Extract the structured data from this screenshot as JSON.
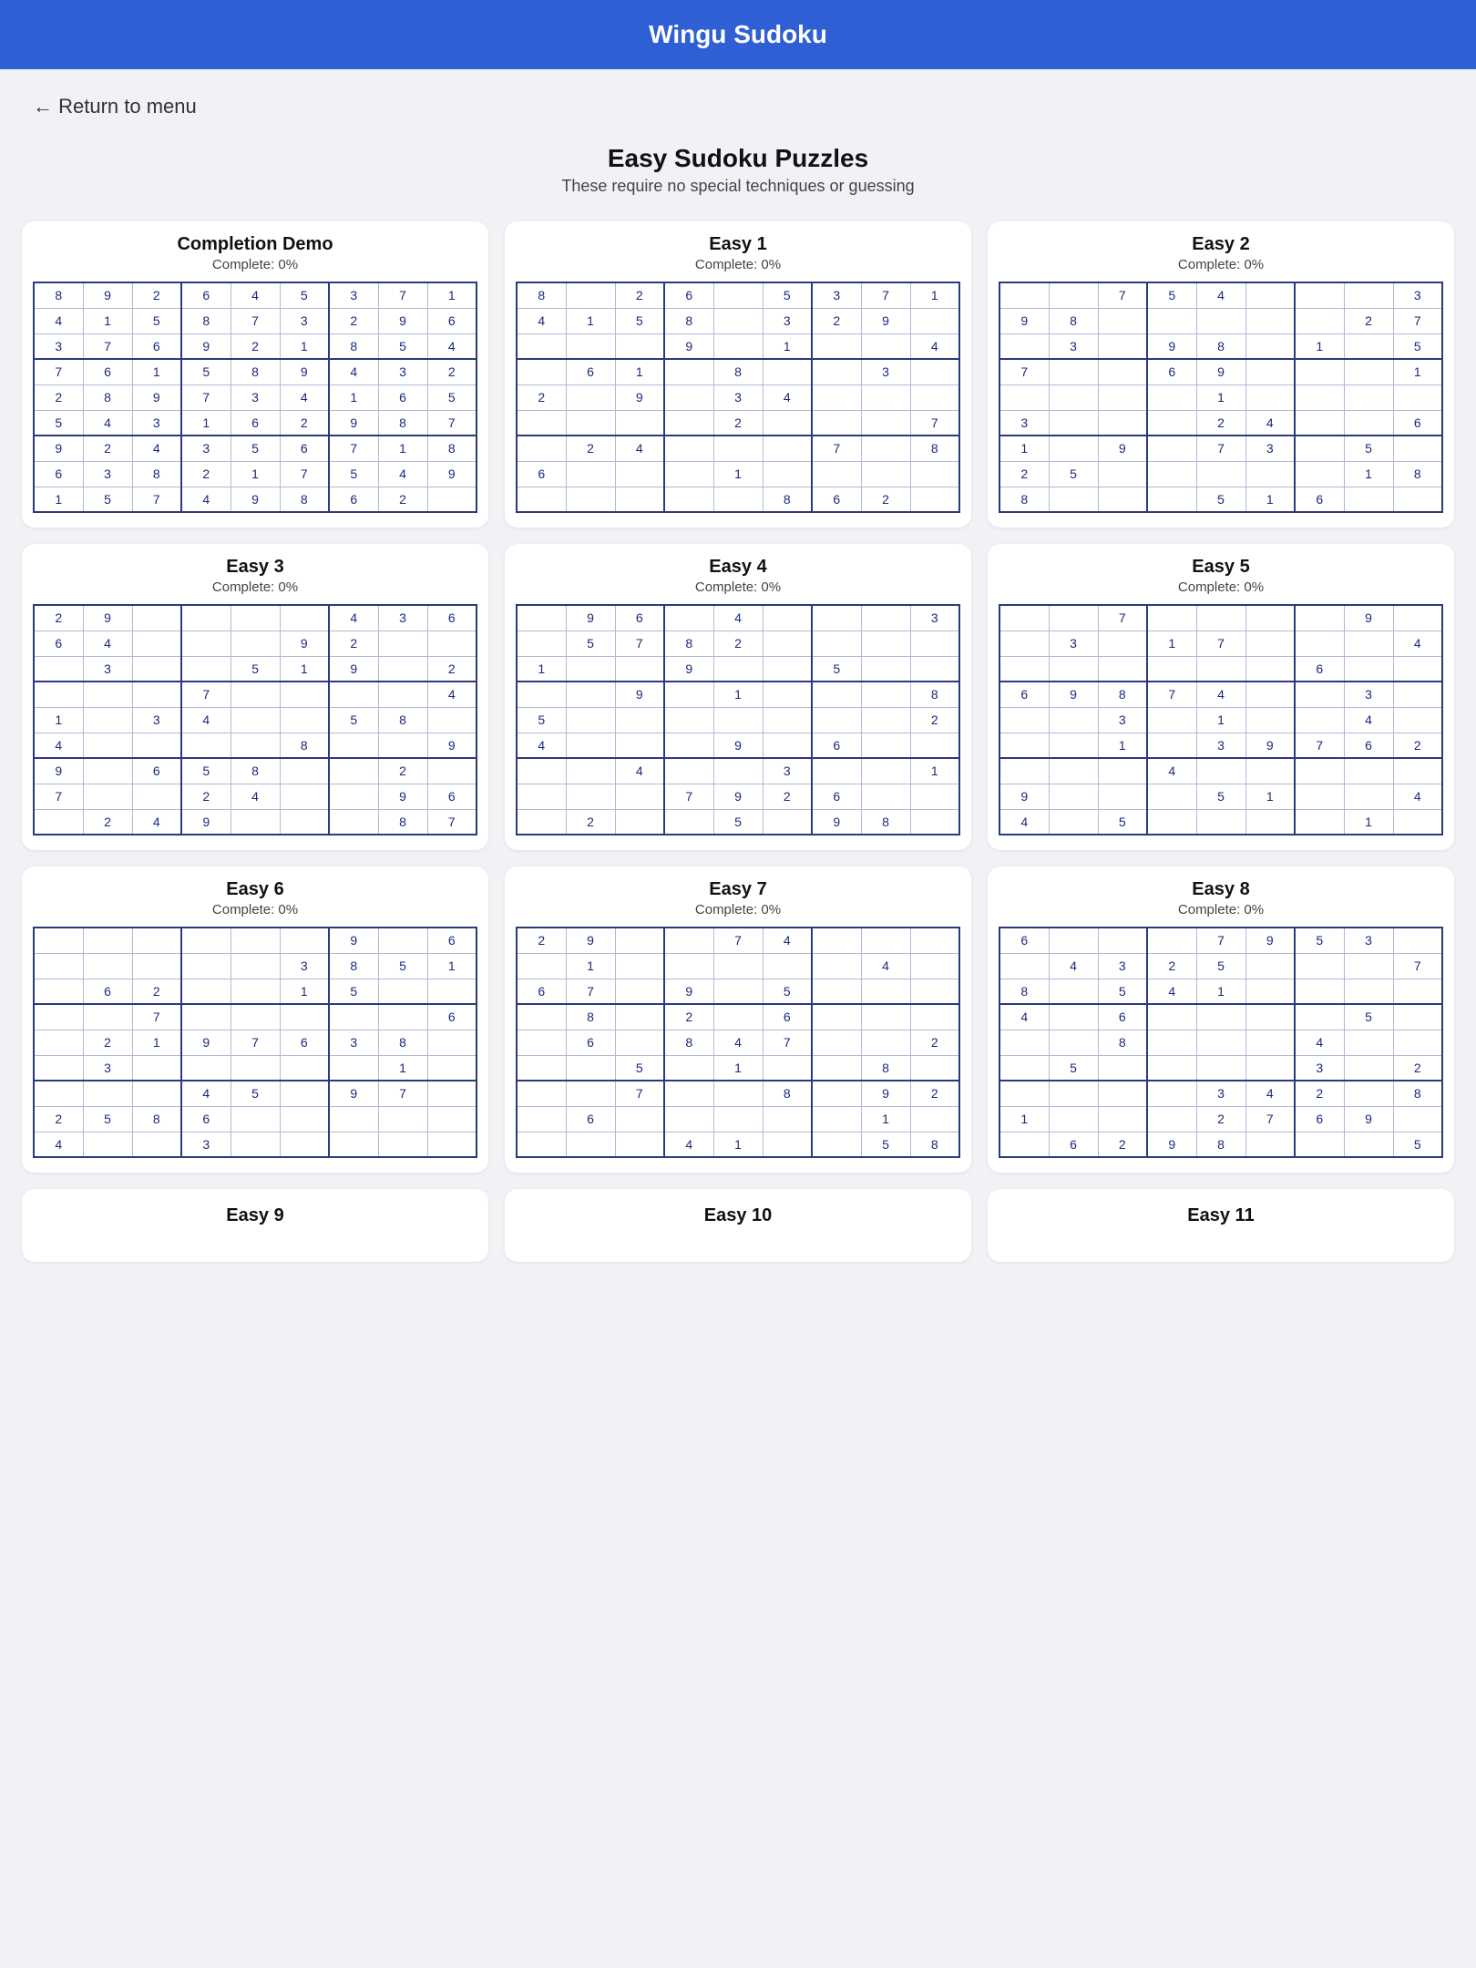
{
  "header": {
    "title": "Wingu Sudoku"
  },
  "nav": {
    "back_label": "← Return to menu"
  },
  "page": {
    "title": "Easy Sudoku Puzzles",
    "subtitle": "These require no special techniques or guessing"
  },
  "puzzles": [
    {
      "id": "completion-demo",
      "title": "Completion Demo",
      "complete": "Complete: 0%",
      "grid": [
        [
          8,
          9,
          2,
          6,
          4,
          5,
          3,
          7,
          1
        ],
        [
          4,
          1,
          5,
          8,
          7,
          3,
          2,
          9,
          6
        ],
        [
          3,
          7,
          6,
          9,
          2,
          1,
          8,
          5,
          4
        ],
        [
          7,
          6,
          1,
          5,
          8,
          9,
          4,
          3,
          2
        ],
        [
          2,
          8,
          9,
          7,
          3,
          4,
          1,
          6,
          5
        ],
        [
          5,
          4,
          3,
          1,
          6,
          2,
          9,
          8,
          7
        ],
        [
          9,
          2,
          4,
          3,
          5,
          6,
          7,
          1,
          8
        ],
        [
          6,
          3,
          8,
          2,
          1,
          7,
          5,
          4,
          9
        ],
        [
          1,
          5,
          7,
          4,
          9,
          8,
          6,
          2,
          0
        ]
      ]
    },
    {
      "id": "easy-1",
      "title": "Easy 1",
      "complete": "Complete: 0%",
      "grid": [
        [
          8,
          0,
          2,
          6,
          0,
          5,
          3,
          7,
          1
        ],
        [
          4,
          1,
          5,
          8,
          0,
          3,
          2,
          9,
          0
        ],
        [
          0,
          0,
          0,
          9,
          0,
          1,
          0,
          0,
          4
        ],
        [
          0,
          6,
          1,
          0,
          8,
          0,
          0,
          3,
          0
        ],
        [
          2,
          0,
          9,
          0,
          3,
          4,
          0,
          0,
          0
        ],
        [
          0,
          0,
          0,
          0,
          2,
          0,
          0,
          0,
          7
        ],
        [
          0,
          2,
          4,
          0,
          0,
          0,
          7,
          0,
          8
        ],
        [
          6,
          0,
          0,
          0,
          1,
          0,
          0,
          0,
          0
        ],
        [
          0,
          0,
          0,
          0,
          0,
          8,
          6,
          2,
          0
        ]
      ]
    },
    {
      "id": "easy-2",
      "title": "Easy 2",
      "complete": "Complete: 0%",
      "grid": [
        [
          0,
          0,
          7,
          5,
          4,
          0,
          0,
          0,
          3
        ],
        [
          9,
          8,
          0,
          0,
          0,
          0,
          0,
          2,
          7
        ],
        [
          0,
          3,
          0,
          9,
          8,
          0,
          1,
          0,
          5
        ],
        [
          7,
          0,
          0,
          6,
          9,
          0,
          0,
          0,
          1
        ],
        [
          0,
          0,
          0,
          0,
          1,
          0,
          0,
          0,
          0
        ],
        [
          3,
          0,
          0,
          0,
          2,
          4,
          0,
          0,
          6
        ],
        [
          1,
          0,
          9,
          0,
          7,
          3,
          0,
          5,
          0
        ],
        [
          2,
          5,
          0,
          0,
          0,
          0,
          0,
          1,
          8
        ],
        [
          8,
          0,
          0,
          0,
          5,
          1,
          6,
          0,
          0
        ]
      ]
    },
    {
      "id": "easy-3",
      "title": "Easy 3",
      "complete": "Complete: 0%",
      "grid": [
        [
          2,
          9,
          0,
          0,
          0,
          0,
          4,
          3,
          6
        ],
        [
          6,
          4,
          0,
          0,
          0,
          9,
          2,
          0,
          0
        ],
        [
          0,
          3,
          0,
          0,
          5,
          1,
          9,
          0,
          2
        ],
        [
          0,
          0,
          0,
          7,
          0,
          0,
          0,
          0,
          4
        ],
        [
          1,
          0,
          3,
          4,
          0,
          0,
          5,
          8,
          0
        ],
        [
          4,
          0,
          0,
          0,
          0,
          8,
          0,
          0,
          9
        ],
        [
          9,
          0,
          6,
          5,
          8,
          0,
          0,
          2,
          0
        ],
        [
          7,
          0,
          0,
          2,
          4,
          0,
          0,
          9,
          6
        ],
        [
          0,
          2,
          4,
          9,
          0,
          0,
          0,
          8,
          7
        ]
      ]
    },
    {
      "id": "easy-4",
      "title": "Easy 4",
      "complete": "Complete: 0%",
      "grid": [
        [
          0,
          9,
          6,
          0,
          4,
          0,
          0,
          0,
          3
        ],
        [
          0,
          5,
          7,
          8,
          2,
          0,
          0,
          0,
          0
        ],
        [
          1,
          0,
          0,
          9,
          0,
          0,
          5,
          0,
          0
        ],
        [
          0,
          0,
          9,
          0,
          1,
          0,
          0,
          0,
          8
        ],
        [
          5,
          0,
          0,
          0,
          0,
          0,
          0,
          0,
          2
        ],
        [
          4,
          0,
          0,
          0,
          9,
          0,
          6,
          0,
          0
        ],
        [
          0,
          0,
          4,
          0,
          0,
          3,
          0,
          0,
          1
        ],
        [
          0,
          0,
          0,
          7,
          9,
          2,
          6,
          0,
          0
        ],
        [
          0,
          2,
          0,
          0,
          5,
          0,
          9,
          8,
          0
        ]
      ]
    },
    {
      "id": "easy-5",
      "title": "Easy 5",
      "complete": "Complete: 0%",
      "grid": [
        [
          0,
          0,
          7,
          0,
          0,
          0,
          0,
          9,
          0
        ],
        [
          0,
          3,
          0,
          1,
          7,
          0,
          0,
          0,
          4
        ],
        [
          0,
          0,
          0,
          0,
          0,
          0,
          6,
          0,
          0
        ],
        [
          6,
          9,
          8,
          7,
          4,
          0,
          0,
          3,
          0
        ],
        [
          0,
          0,
          3,
          0,
          1,
          0,
          0,
          4,
          0
        ],
        [
          0,
          0,
          1,
          0,
          3,
          9,
          7,
          6,
          2
        ],
        [
          0,
          0,
          0,
          4,
          0,
          0,
          0,
          0,
          0
        ],
        [
          9,
          0,
          0,
          0,
          5,
          1,
          0,
          0,
          4
        ],
        [
          4,
          0,
          5,
          0,
          0,
          0,
          0,
          1,
          0
        ]
      ]
    },
    {
      "id": "easy-6",
      "title": "Easy 6",
      "complete": "Complete: 0%",
      "grid": [
        [
          0,
          0,
          0,
          0,
          0,
          0,
          9,
          0,
          6
        ],
        [
          0,
          0,
          0,
          0,
          0,
          3,
          8,
          5,
          1
        ],
        [
          0,
          6,
          2,
          0,
          0,
          1,
          5,
          0,
          0
        ],
        [
          0,
          0,
          7,
          0,
          0,
          0,
          0,
          0,
          6
        ],
        [
          0,
          2,
          1,
          9,
          7,
          6,
          3,
          8,
          0
        ],
        [
          0,
          3,
          0,
          0,
          0,
          0,
          0,
          1,
          0
        ],
        [
          0,
          0,
          0,
          4,
          5,
          0,
          9,
          7,
          0
        ],
        [
          2,
          5,
          8,
          6,
          0,
          0,
          0,
          0,
          0
        ],
        [
          4,
          0,
          0,
          3,
          0,
          0,
          0,
          0,
          0
        ]
      ]
    },
    {
      "id": "easy-7",
      "title": "Easy 7",
      "complete": "Complete: 0%",
      "grid": [
        [
          2,
          9,
          0,
          0,
          7,
          4,
          0,
          0,
          0
        ],
        [
          0,
          1,
          0,
          0,
          0,
          0,
          0,
          4,
          0
        ],
        [
          6,
          7,
          0,
          9,
          0,
          5,
          0,
          0,
          0
        ],
        [
          0,
          8,
          0,
          2,
          0,
          6,
          0,
          0,
          0
        ],
        [
          0,
          6,
          0,
          8,
          4,
          7,
          0,
          0,
          2
        ],
        [
          0,
          0,
          5,
          0,
          1,
          0,
          0,
          8,
          0
        ],
        [
          0,
          0,
          7,
          0,
          0,
          8,
          0,
          9,
          2
        ],
        [
          0,
          6,
          0,
          0,
          0,
          0,
          0,
          1,
          0
        ],
        [
          0,
          0,
          0,
          4,
          1,
          0,
          0,
          5,
          8
        ]
      ]
    },
    {
      "id": "easy-8",
      "title": "Easy 8",
      "complete": "Complete: 0%",
      "grid": [
        [
          6,
          0,
          0,
          0,
          7,
          9,
          5,
          3,
          0
        ],
        [
          0,
          4,
          3,
          2,
          5,
          0,
          0,
          0,
          7
        ],
        [
          8,
          0,
          5,
          4,
          1,
          0,
          0,
          0,
          0
        ],
        [
          4,
          0,
          6,
          0,
          0,
          0,
          0,
          5,
          0
        ],
        [
          0,
          0,
          8,
          0,
          0,
          0,
          4,
          0,
          0
        ],
        [
          0,
          5,
          0,
          0,
          0,
          0,
          3,
          0,
          2
        ],
        [
          0,
          0,
          0,
          0,
          3,
          4,
          2,
          0,
          8
        ],
        [
          1,
          0,
          0,
          0,
          2,
          7,
          6,
          9,
          0
        ],
        [
          0,
          6,
          2,
          9,
          8,
          0,
          0,
          0,
          5
        ]
      ]
    }
  ],
  "bottom_cards": [
    {
      "title": "Easy 9"
    },
    {
      "title": "Easy 10"
    },
    {
      "title": "Easy 11"
    }
  ]
}
